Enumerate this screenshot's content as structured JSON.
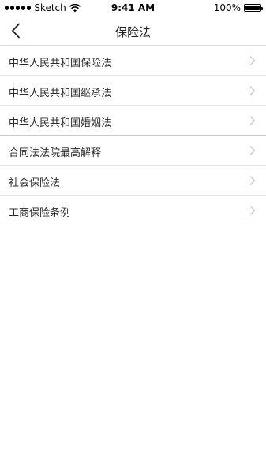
{
  "status_bar": {
    "carrier": "Sketch",
    "time": "9:41 AM",
    "battery": "100%",
    "icons": [
      "signal-dots-icon",
      "wifi-icon",
      "battery-icon"
    ]
  },
  "nav": {
    "title": "保险法",
    "back_icon": "chevron-left-icon"
  },
  "list": {
    "items": [
      {
        "label": "中华人民共和国保险法"
      },
      {
        "label": "中华人民共和国继承法"
      },
      {
        "label": "中华人民共和国婚姻法"
      },
      {
        "label": "合同法法院最高解释"
      },
      {
        "label": "社会保险法"
      },
      {
        "label": "工商保险条例"
      }
    ],
    "item_icon": "chevron-right-icon"
  },
  "colors": {
    "background": "#ffffff",
    "divider": "#e4e4e4",
    "chevron": "#c7c7cc",
    "text": "#222222"
  }
}
